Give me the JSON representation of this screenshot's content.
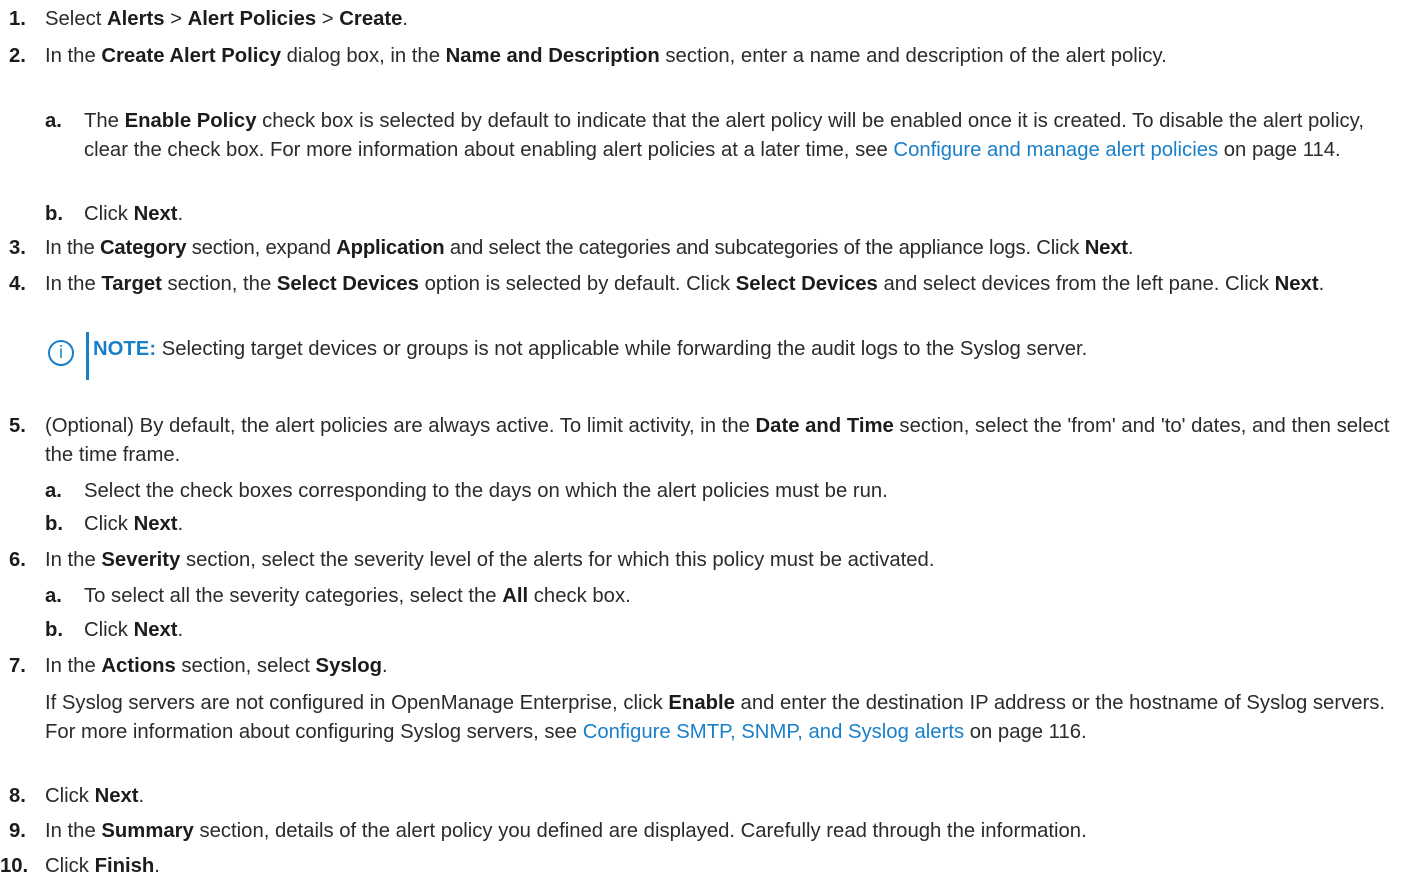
{
  "steps": [
    {
      "num": "1.",
      "p": [
        "Select ",
        "Alerts",
        " > ",
        "Alert Policies",
        " > ",
        "Create",
        "."
      ]
    },
    {
      "num": "2.",
      "p": [
        "In the ",
        "Create Alert Policy",
        " dialog box, in the ",
        "Name and Description",
        " section, enter a name and description of the alert policy."
      ],
      "subs": [
        {
          "num": "a.",
          "p": [
            "The ",
            "Enable Policy",
            " check box is selected by default to indicate that the alert policy will be enabled once it is created. To disable the alert policy, clear the check box. For more information about enabling alert policies at a later time, see "
          ],
          "link": "Configure and manage alert policies",
          "after": " on page 114."
        },
        {
          "num": "b.",
          "p": [
            "Click ",
            "Next",
            "."
          ]
        }
      ]
    },
    {
      "num": "3.",
      "p": [
        "In the ",
        "Category",
        " section, expand ",
        "Application",
        " and select the categories and subcategories of the appliance logs. Click ",
        "Next",
        "."
      ]
    },
    {
      "num": "4.",
      "p": [
        "In the ",
        "Target",
        " section, the ",
        "Select Devices",
        " option is selected by default. Click ",
        "Select Devices",
        " and select devices from the left pane. Click ",
        "Next",
        "."
      ]
    },
    {
      "num": "5.",
      "p": [
        "(Optional) By default, the alert policies are always active. To limit activity, in the ",
        "Date and Time",
        " section, select the 'from' and 'to' dates, and then select the time frame."
      ],
      "subs": [
        {
          "num": "a.",
          "p": [
            "Select the check boxes corresponding to the days on which the alert policies must be run."
          ]
        },
        {
          "num": "b.",
          "p": [
            "Click ",
            "Next",
            "."
          ]
        }
      ]
    },
    {
      "num": "6.",
      "p": [
        "In the ",
        "Severity",
        " section, select the severity level of the alerts for which this policy must be activated."
      ],
      "subs": [
        {
          "num": "a.",
          "p": [
            "To select all the severity categories, select the ",
            "All",
            " check box."
          ]
        },
        {
          "num": "b.",
          "p": [
            "Click ",
            "Next",
            "."
          ]
        }
      ]
    },
    {
      "num": "7.",
      "p": [
        "In the ",
        "Actions",
        " section, select ",
        "Syslog",
        "."
      ],
      "extra": {
        "p": [
          "If Syslog servers are not configured in OpenManage Enterprise, click ",
          "Enable",
          " and enter the destination IP address or the hostname of Syslog servers. For more information about configuring Syslog servers, see "
        ],
        "link": "Configure SMTP, SNMP, and Syslog alerts",
        "after": " on page 116."
      }
    },
    {
      "num": "8.",
      "p": [
        "Click ",
        "Next",
        "."
      ]
    },
    {
      "num": "9.",
      "p": [
        "In the ",
        "Summary",
        " section, details of the alert policy you defined are displayed. Carefully read through the information."
      ]
    },
    {
      "num": "10.",
      "p": [
        "Click ",
        "Finish",
        "."
      ]
    }
  ],
  "note": {
    "label": "NOTE:",
    "text": " Selecting target devices or groups is not applicable while forwarding the audit logs to the Syslog server.",
    "icon": "info-icon"
  }
}
